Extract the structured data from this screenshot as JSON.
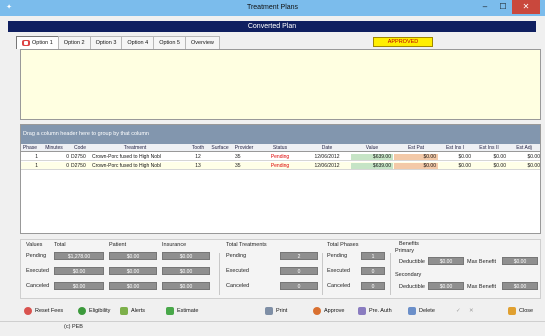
{
  "window": {
    "title": "Treatment Plans",
    "minimize": "–",
    "maximize": "☐",
    "close": "✕"
  },
  "banner": "Converted Plan",
  "tabs": [
    {
      "label": "Option 1",
      "icon": "tooth-icon"
    },
    {
      "label": "Option 2"
    },
    {
      "label": "Option 3"
    },
    {
      "label": "Option 4"
    },
    {
      "label": "Option 5"
    },
    {
      "label": "Overview"
    }
  ],
  "status_badge": "APPROVED",
  "grid": {
    "group_hint": "Drag a column header here to group by that column",
    "columns": [
      "Phase",
      "Minutes",
      "Code",
      "Treatment",
      "Tooth",
      "Surface",
      "Provider",
      "Status",
      "Date",
      "Value",
      "Est Pat",
      "Est Ins I",
      "Est Ins II",
      "Est Adj"
    ],
    "rows": [
      {
        "phase": "1",
        "minutes": "0",
        "code": "D2750",
        "treatment": "Crown-Porc fused to High Nobl",
        "tooth": "12",
        "surface": "",
        "provider": "35",
        "status": "Pending",
        "date": "12/06/2012",
        "value": "$639.00",
        "est_pat": "$0.00",
        "est_ins1": "$0.00",
        "est_ins2": "$0.00",
        "est_adj": "$0.00"
      },
      {
        "phase": "1",
        "minutes": "0",
        "code": "D2750",
        "treatment": "Crown-Porc fused to High Nobl",
        "tooth": "13",
        "surface": "",
        "provider": "35",
        "status": "Pending",
        "date": "12/06/2012",
        "value": "$639.00",
        "est_pat": "$0.00",
        "est_ins1": "$0.00",
        "est_ins2": "$0.00",
        "est_adj": "$0.00"
      }
    ]
  },
  "summary": {
    "values_label": "Values",
    "col_total": "Total",
    "col_patient": "Patient",
    "col_insurance": "Insurance",
    "pending_label": "Pending",
    "executed_label": "Executed",
    "canceled_label": "Canceled",
    "pending": {
      "total": "$1,278.00",
      "patient": "$0.00",
      "insurance": "$0.00"
    },
    "executed": {
      "total": "$0.00",
      "patient": "$0.00",
      "insurance": "$0.00"
    },
    "canceled": {
      "total": "$0.00",
      "patient": "$0.00",
      "insurance": "$0.00"
    },
    "total_treatments_label": "Total Treatments",
    "treatments": {
      "pending": "2",
      "executed": "0",
      "canceled": "0"
    },
    "total_phases_label": "Total Phases",
    "phases": {
      "pending": "1",
      "executed": "0",
      "canceled": "0"
    },
    "benefits_label": "Benefits",
    "primary_label": "Primary",
    "secondary_label": "Secondary",
    "deductible_label": "Deductible",
    "max_benefit_label": "Max Benefit",
    "primary": {
      "deductible": "$0.00",
      "max_benefit": "$0.00"
    },
    "secondary": {
      "deductible": "$0.00",
      "max_benefit": "$0.00"
    }
  },
  "toolbar": {
    "reset_fees": "Reset Fees",
    "eligibility": "Eligibility",
    "alerts": "Alerts",
    "estimate": "Estimate",
    "print": "Print",
    "approve": "Approve",
    "pre_auth": "Pre. Auth",
    "delete": "Delete",
    "check": "✓",
    "x": "✕",
    "close": "Close"
  },
  "status_bar": "(c) PEB"
}
